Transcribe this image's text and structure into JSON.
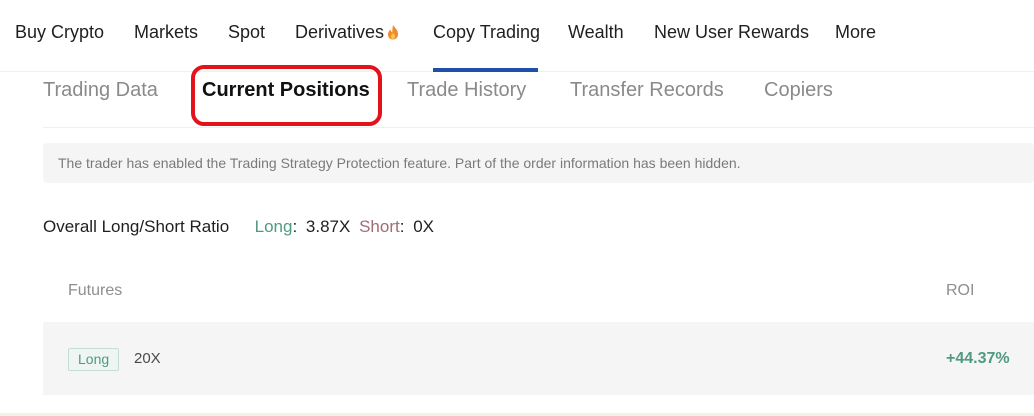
{
  "nav": {
    "items": [
      "Buy Crypto",
      "Markets",
      "Spot",
      "Derivatives",
      "Copy Trading",
      "Wealth",
      "New User Rewards",
      "More"
    ],
    "active": "Copy Trading",
    "accent_color": "#1f4fa6"
  },
  "tabs": {
    "items": [
      "Trading Data",
      "Current Positions",
      "Trade History",
      "Transfer Records",
      "Copiers"
    ],
    "active": "Current Positions",
    "highlight_color": "#e2131b"
  },
  "notice": {
    "text": "The trader has enabled the Trading Strategy Protection feature. Part of the order information has been hidden."
  },
  "ratio": {
    "label": "Overall Long/Short Ratio",
    "long_label": "Long",
    "long_value": "3.87X",
    "short_label": "Short",
    "short_value": "0X",
    "separator": ":"
  },
  "table": {
    "headers": {
      "futures": "Futures",
      "roi": "ROI"
    },
    "rows": [
      {
        "side": "Long",
        "leverage": "20X",
        "roi": "+44.37%"
      }
    ]
  },
  "colors": {
    "long": "#4f9a82",
    "short": "#a06c76"
  }
}
